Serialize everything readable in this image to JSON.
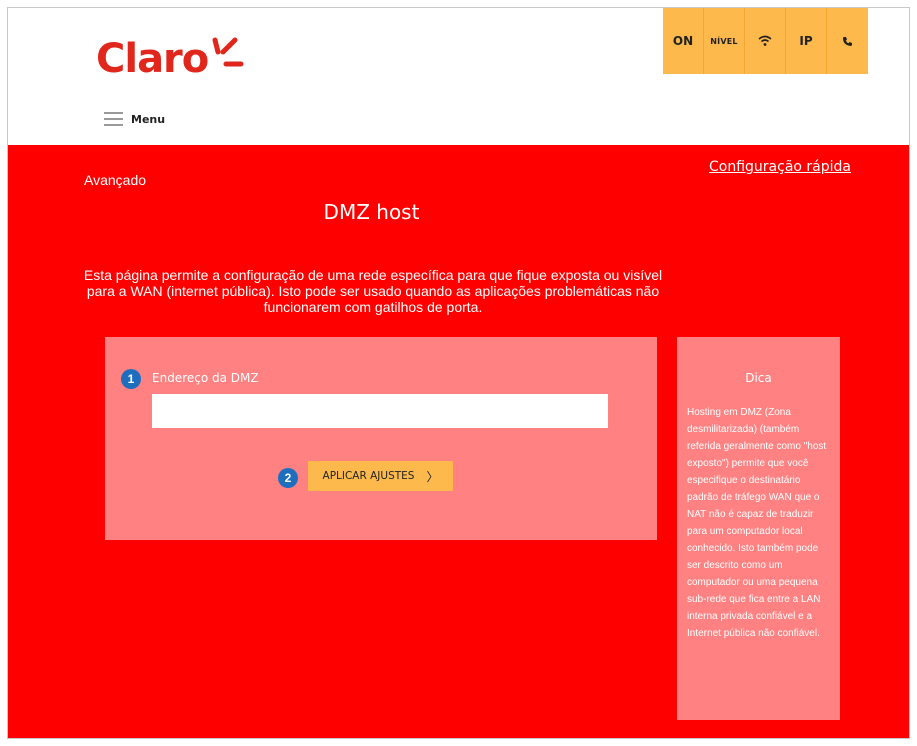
{
  "header": {
    "logo_text": "Claro",
    "status_buttons": [
      {
        "label": "ON",
        "name": "status-on"
      },
      {
        "label": "NÍVEL",
        "name": "status-nivel"
      },
      {
        "icon": "wifi-icon",
        "name": "status-wifi"
      },
      {
        "label": "IP",
        "name": "status-ip"
      },
      {
        "icon": "phone-icon",
        "name": "status-phone"
      }
    ],
    "menu_label": "Menu"
  },
  "main": {
    "breadcrumb": "Avançado",
    "quick_config_link": "Configuração rápida",
    "title": "DMZ host",
    "description": "Esta página permite a configuração de uma rede específica para que fique exposta ou visível para a WAN (internet pública). Isto pode ser usado quando as aplicações problemáticas não funcionarem com gatilhos de porta.",
    "form": {
      "step1": "1",
      "dmz_label": "Endereço da DMZ",
      "dmz_value": "",
      "dmz_placeholder": "",
      "step2": "2",
      "apply_label": "APLICAR AJUSTES"
    },
    "tip": {
      "title": "Dica",
      "text": "Hosting em DMZ (Zona desmilitarizada) (também referida geralmente como \"host exposto\") permite que você especifique o destinatário padrão de tráfego WAN que o NAT não é capaz de traduzir para um computador local conhecido. Isto também pode ser descrito como um computador ou uma pequena sub-rede que fica entre a LAN interna privada confiável e a Internet pública não confiável."
    }
  },
  "colors": {
    "brand_red": "#ff0000",
    "logo_red": "#e1261c",
    "panel_pink": "#ff8181",
    "accent_yellow": "#fdb94b",
    "badge_blue": "#1e6ec0"
  }
}
